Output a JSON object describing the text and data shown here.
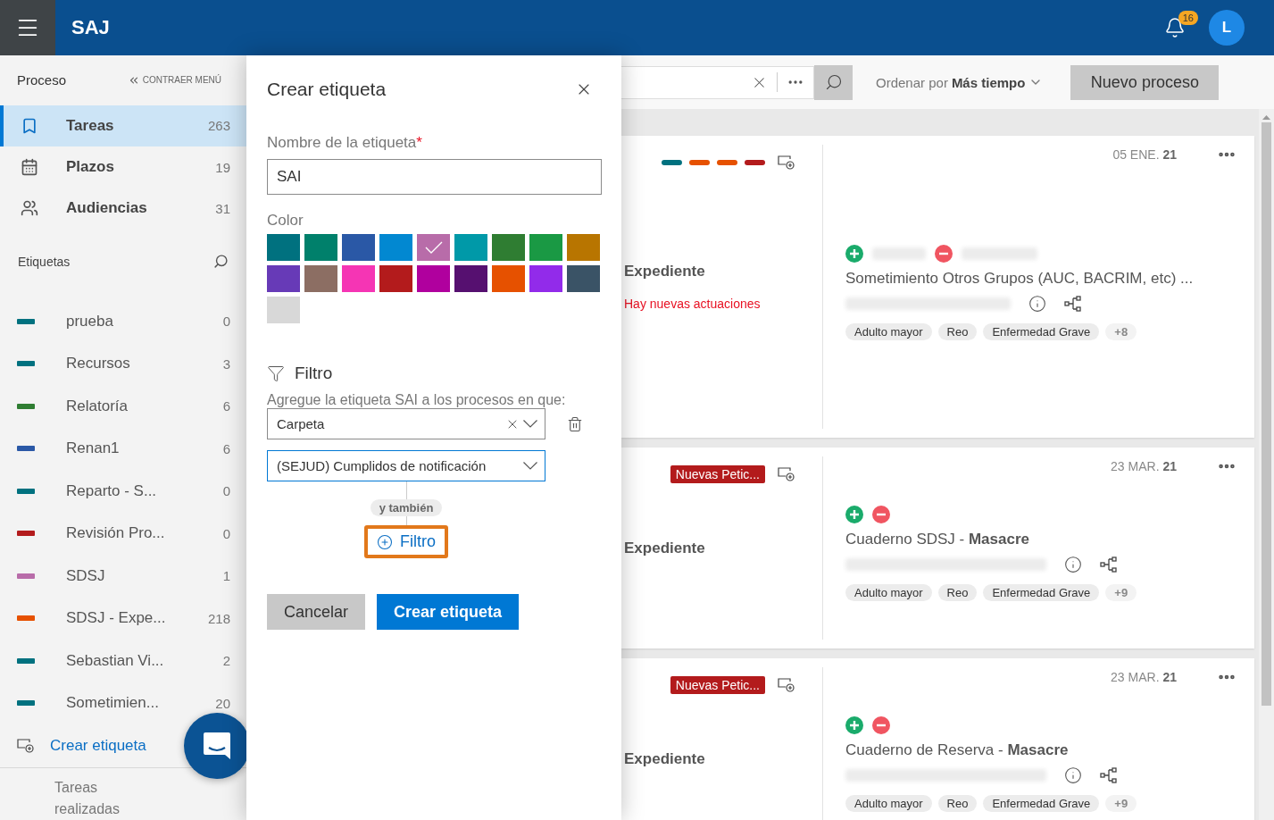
{
  "header": {
    "app_name": "SAJ",
    "notifications": "16",
    "avatar": "L"
  },
  "sidebar": {
    "section_title": "Proceso",
    "collapse": "CONTRAER MENÚ",
    "nav": [
      {
        "label": "Tareas",
        "count": "263",
        "selected": true
      },
      {
        "label": "Plazos",
        "count": "19",
        "selected": false
      },
      {
        "label": "Audiencias",
        "count": "31",
        "selected": false
      }
    ],
    "labels_title": "Etiquetas",
    "labels": [
      {
        "name": "prueba",
        "count": "0",
        "color": "#00717f"
      },
      {
        "name": "Recursos",
        "count": "3",
        "color": "#00717f"
      },
      {
        "name": "Relatoría",
        "count": "6",
        "color": "#2f7d32"
      },
      {
        "name": "Renan1",
        "count": "6",
        "color": "#2a58a6"
      },
      {
        "name": "Reparto - S...",
        "count": "0",
        "color": "#00717f"
      },
      {
        "name": "Revisión Pro...",
        "count": "0",
        "color": "#b31b1c"
      },
      {
        "name": "SDSJ",
        "count": "1",
        "color": "#b86ca9"
      },
      {
        "name": "SDSJ - Expe...",
        "count": "218",
        "color": "#e65100"
      },
      {
        "name": "Sebastian Vi...",
        "count": "2",
        "color": "#00717f"
      },
      {
        "name": "Sometimien...",
        "count": "20",
        "color": "#00717f"
      }
    ],
    "create_label": "Crear etiqueta",
    "footer": "Tareas realizadas"
  },
  "dialog": {
    "title": "Crear etiqueta",
    "name_label": "Nombre de la etiqueta",
    "required_mark": "*",
    "name_value": "SAI",
    "color_label": "Color",
    "colors": [
      {
        "color": "#00717f",
        "selected": false
      },
      {
        "color": "#00806b",
        "selected": false
      },
      {
        "color": "#2a58a6",
        "selected": false
      },
      {
        "color": "#0288d1",
        "selected": false
      },
      {
        "color": "#b86ca9",
        "selected": true
      },
      {
        "color": "#0099a8",
        "selected": false
      },
      {
        "color": "#2f7d32",
        "selected": false
      },
      {
        "color": "#1a9944",
        "selected": false
      },
      {
        "color": "#b87500",
        "selected": false
      },
      {
        "color": "#673ab7",
        "selected": false
      },
      {
        "color": "#8c6e63",
        "selected": false
      },
      {
        "color": "#f535b4",
        "selected": false
      },
      {
        "color": "#b31b1c",
        "selected": false
      },
      {
        "color": "#b0009e",
        "selected": false
      },
      {
        "color": "#561070",
        "selected": false
      },
      {
        "color": "#e65100",
        "selected": false
      },
      {
        "color": "#922bea",
        "selected": false
      },
      {
        "color": "#3a5366",
        "selected": false
      },
      {
        "color": "#d8d8d8",
        "selected": false
      }
    ],
    "filter_title": "Filtro",
    "filter_hint": "Agregue la etiqueta SAI a los procesos en que:",
    "filters": [
      {
        "value": "Carpeta",
        "clearable": true,
        "focused": false,
        "removable": true
      },
      {
        "value": "(SEJUD) Cumplidos de notificación",
        "clearable": false,
        "focused": true,
        "removable": false
      }
    ],
    "connector": "y también",
    "add_filter": {
      "label": "Filtro",
      "highlighted": true
    },
    "buttons": [
      {
        "label": "Cancelar",
        "kind": "secondary"
      },
      {
        "label": "Crear etiqueta",
        "kind": "primary"
      }
    ]
  },
  "toolbar": {
    "sort_label": "Ordenar por",
    "sort_value": "Más tiempo",
    "new_button": "Nuevo proceso"
  },
  "cards": [
    {
      "status_bars": [
        {
          "color": "#00717f"
        },
        {
          "color": "#e65100"
        },
        {
          "color": "#e65100"
        },
        {
          "color": "#b31b1c"
        }
      ],
      "heading": "Expediente",
      "notice": "Hay nuevas actuaciones",
      "date": "05 ENE.",
      "date_year": "21",
      "parties_redacted": true,
      "title": "Sometimiento Otros Grupos (AUC, BACRIM, etc) ...",
      "chips": [
        "Adulto mayor",
        "Reo",
        "Enfermedad Grave"
      ],
      "more_chips": "+8"
    },
    {
      "badge": "Nuevas Petic...",
      "heading": "Expediente",
      "date": "23 MAR.",
      "date_year": "21",
      "parties_redacted": false,
      "title": "Cuaderno SDSJ - **Masacre**",
      "chips": [
        "Adulto mayor",
        "Reo",
        "Enfermedad Grave"
      ],
      "more_chips": "+9"
    },
    {
      "badge": "Nuevas Petic...",
      "heading": "Expediente",
      "date": "23 MAR.",
      "date_year": "21",
      "parties_redacted": false,
      "title": "Cuaderno de Reserva - **Masacre**",
      "chips": [
        "Adulto mayor",
        "Reo",
        "Enfermedad Grave"
      ],
      "more_chips": "+9"
    }
  ]
}
